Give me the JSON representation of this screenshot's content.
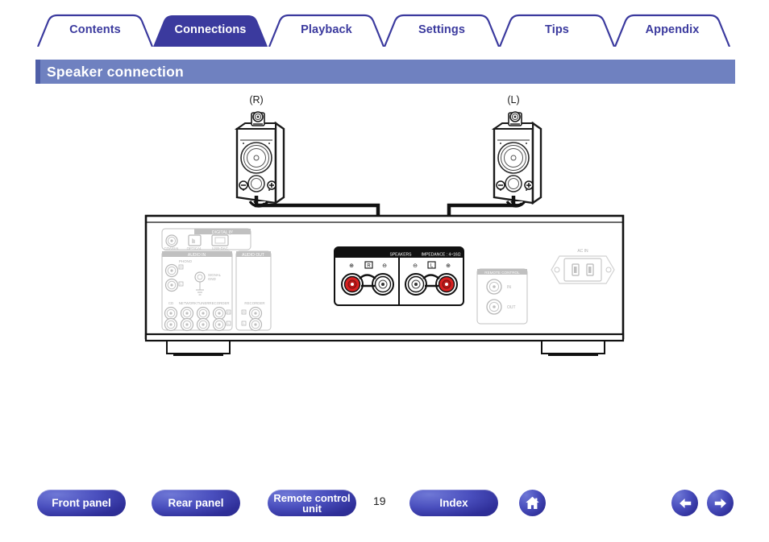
{
  "nav": {
    "tabs": [
      {
        "label": "Contents",
        "active": false,
        "name": "tab-contents"
      },
      {
        "label": "Connections",
        "active": true,
        "name": "tab-connections"
      },
      {
        "label": "Playback",
        "active": false,
        "name": "tab-playback"
      },
      {
        "label": "Settings",
        "active": false,
        "name": "tab-settings"
      },
      {
        "label": "Tips",
        "active": false,
        "name": "tab-tips"
      },
      {
        "label": "Appendix",
        "active": false,
        "name": "tab-appendix"
      }
    ],
    "active_color": "#3b3a9e",
    "inactive_text_color": "#3b3a9e"
  },
  "section": {
    "title": "Speaker connection",
    "bar_color": "#6f81c0",
    "accent_color": "#4f5fa8"
  },
  "diagram": {
    "speakers": [
      {
        "label": "(R)",
        "terminal_minus": "⊖",
        "terminal_plus": "⊕"
      },
      {
        "label": "(L)",
        "terminal_minus": "⊖",
        "terminal_plus": "⊕"
      }
    ],
    "amplifier": {
      "digital_in": {
        "heading": "DIGITAL IN",
        "jacks": [
          "COAXIAL",
          "OPTICAL",
          "USB-DAC"
        ]
      },
      "audio_in": {
        "heading": "AUDIO IN",
        "phono_label": "PHONO",
        "phono_channels": [
          "R",
          "L"
        ],
        "signal_gnd": "SIGNAL GND",
        "sources": [
          "CD",
          "NETWORK",
          "TUNER",
          "RECORDER"
        ],
        "channels": [
          "R",
          "L"
        ]
      },
      "audio_out": {
        "heading": "AUDIO OUT",
        "sources": [
          "RECORDER"
        ],
        "channels": [
          "R",
          "L"
        ]
      },
      "speakers_block": {
        "heading": "SPEAKERS",
        "impedance": "IMPEDANCE : 4 ~ 16Ω",
        "right": {
          "channel": "R",
          "plus": "⊕",
          "minus": "⊖"
        },
        "left": {
          "channel": "L",
          "plus": "⊕",
          "minus": "⊖"
        },
        "positive_color": "#d92121",
        "negative_color": "#ffffff"
      },
      "remote_control": {
        "heading": "REMOTE CONTROL",
        "jacks": [
          "IN",
          "OUT"
        ]
      },
      "ac_inlet": {
        "label": "AC IN"
      }
    }
  },
  "footer": {
    "buttons": [
      {
        "label": "Front panel",
        "name": "front-panel-button"
      },
      {
        "label": "Rear panel",
        "name": "rear-panel-button"
      },
      {
        "label": "Remote control unit",
        "name": "remote-control-unit-button"
      },
      {
        "label": "Index",
        "name": "index-button"
      }
    ],
    "page_number": "19",
    "home_icon": "home-icon",
    "prev_icon": "arrow-left-icon",
    "next_icon": "arrow-right-icon",
    "button_color": "#3230a0"
  }
}
